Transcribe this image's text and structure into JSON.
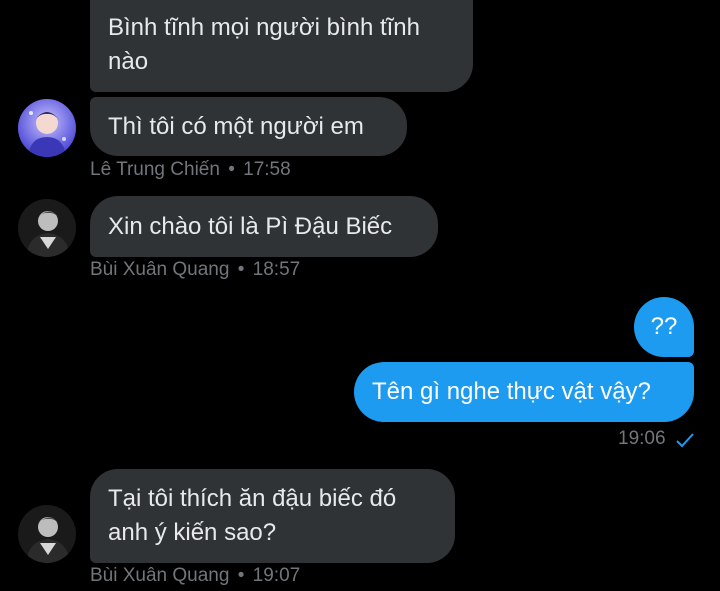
{
  "conversation": {
    "messages": [
      {
        "direction": "incoming",
        "lines": [
          "Bình tĩnh mọi người bình tĩnh",
          "nào"
        ]
      },
      {
        "direction": "incoming",
        "text": "Thì tôi có một người em",
        "sender": "Lê Trung Chiến",
        "time": "17:58",
        "avatar_icon": "anime-avatar-icon"
      },
      {
        "direction": "incoming",
        "text": "Xin chào tôi là Pì Đậu Biếc",
        "sender": "Bùi Xuân Quang",
        "time": "18:57",
        "avatar_icon": "portrait-avatar-icon"
      },
      {
        "direction": "outgoing",
        "text": "??"
      },
      {
        "direction": "outgoing",
        "text": "Tên gì nghe thực vật vậy?",
        "time": "19:06",
        "status_icon": "checkmark-icon"
      },
      {
        "direction": "incoming",
        "lines": [
          "Tại tôi thích ăn đậu biếc đó",
          "anh ý kiến sao?"
        ],
        "sender": "Bùi Xuân Quang",
        "time": "19:07",
        "avatar_icon": "portrait-avatar-icon"
      }
    ],
    "separator": "•"
  },
  "colors": {
    "background": "#000000",
    "incoming_bubble": "#2f3336",
    "outgoing_bubble": "#1d9bf0",
    "meta_text": "#71767b",
    "check": "#1d9bf0"
  }
}
